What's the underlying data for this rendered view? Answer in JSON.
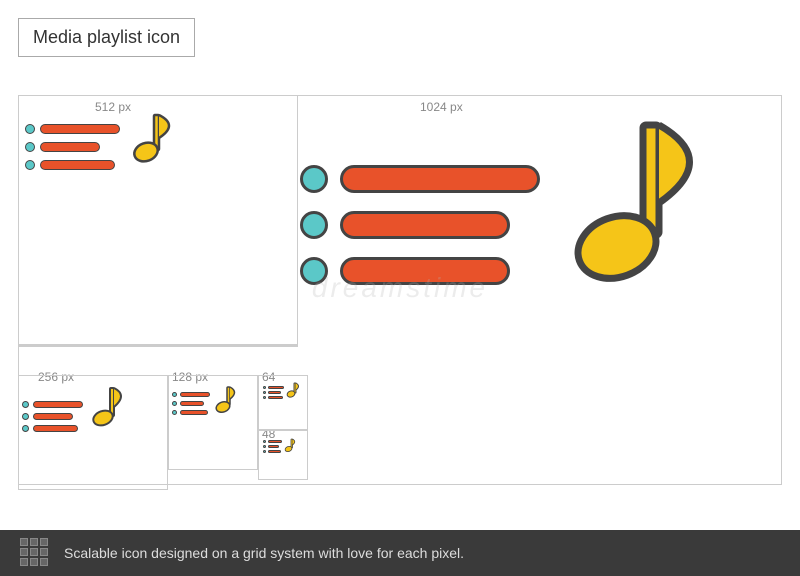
{
  "header": {
    "title": "Media playlist icon"
  },
  "dimensions": {
    "label_1024": "1024 px",
    "label_512": "512 px",
    "label_256": "256 px",
    "label_128": "128 px",
    "label_64": "64",
    "label_48": "48"
  },
  "footer": {
    "text": "Scalable icon designed on a grid system with love for each pixel."
  },
  "watermark": "dreamstime",
  "colors": {
    "dot": "#5bc8c8",
    "bar": "#e8522a",
    "note": "#f5c518",
    "border": "#444444",
    "gridline": "#cccccc"
  }
}
